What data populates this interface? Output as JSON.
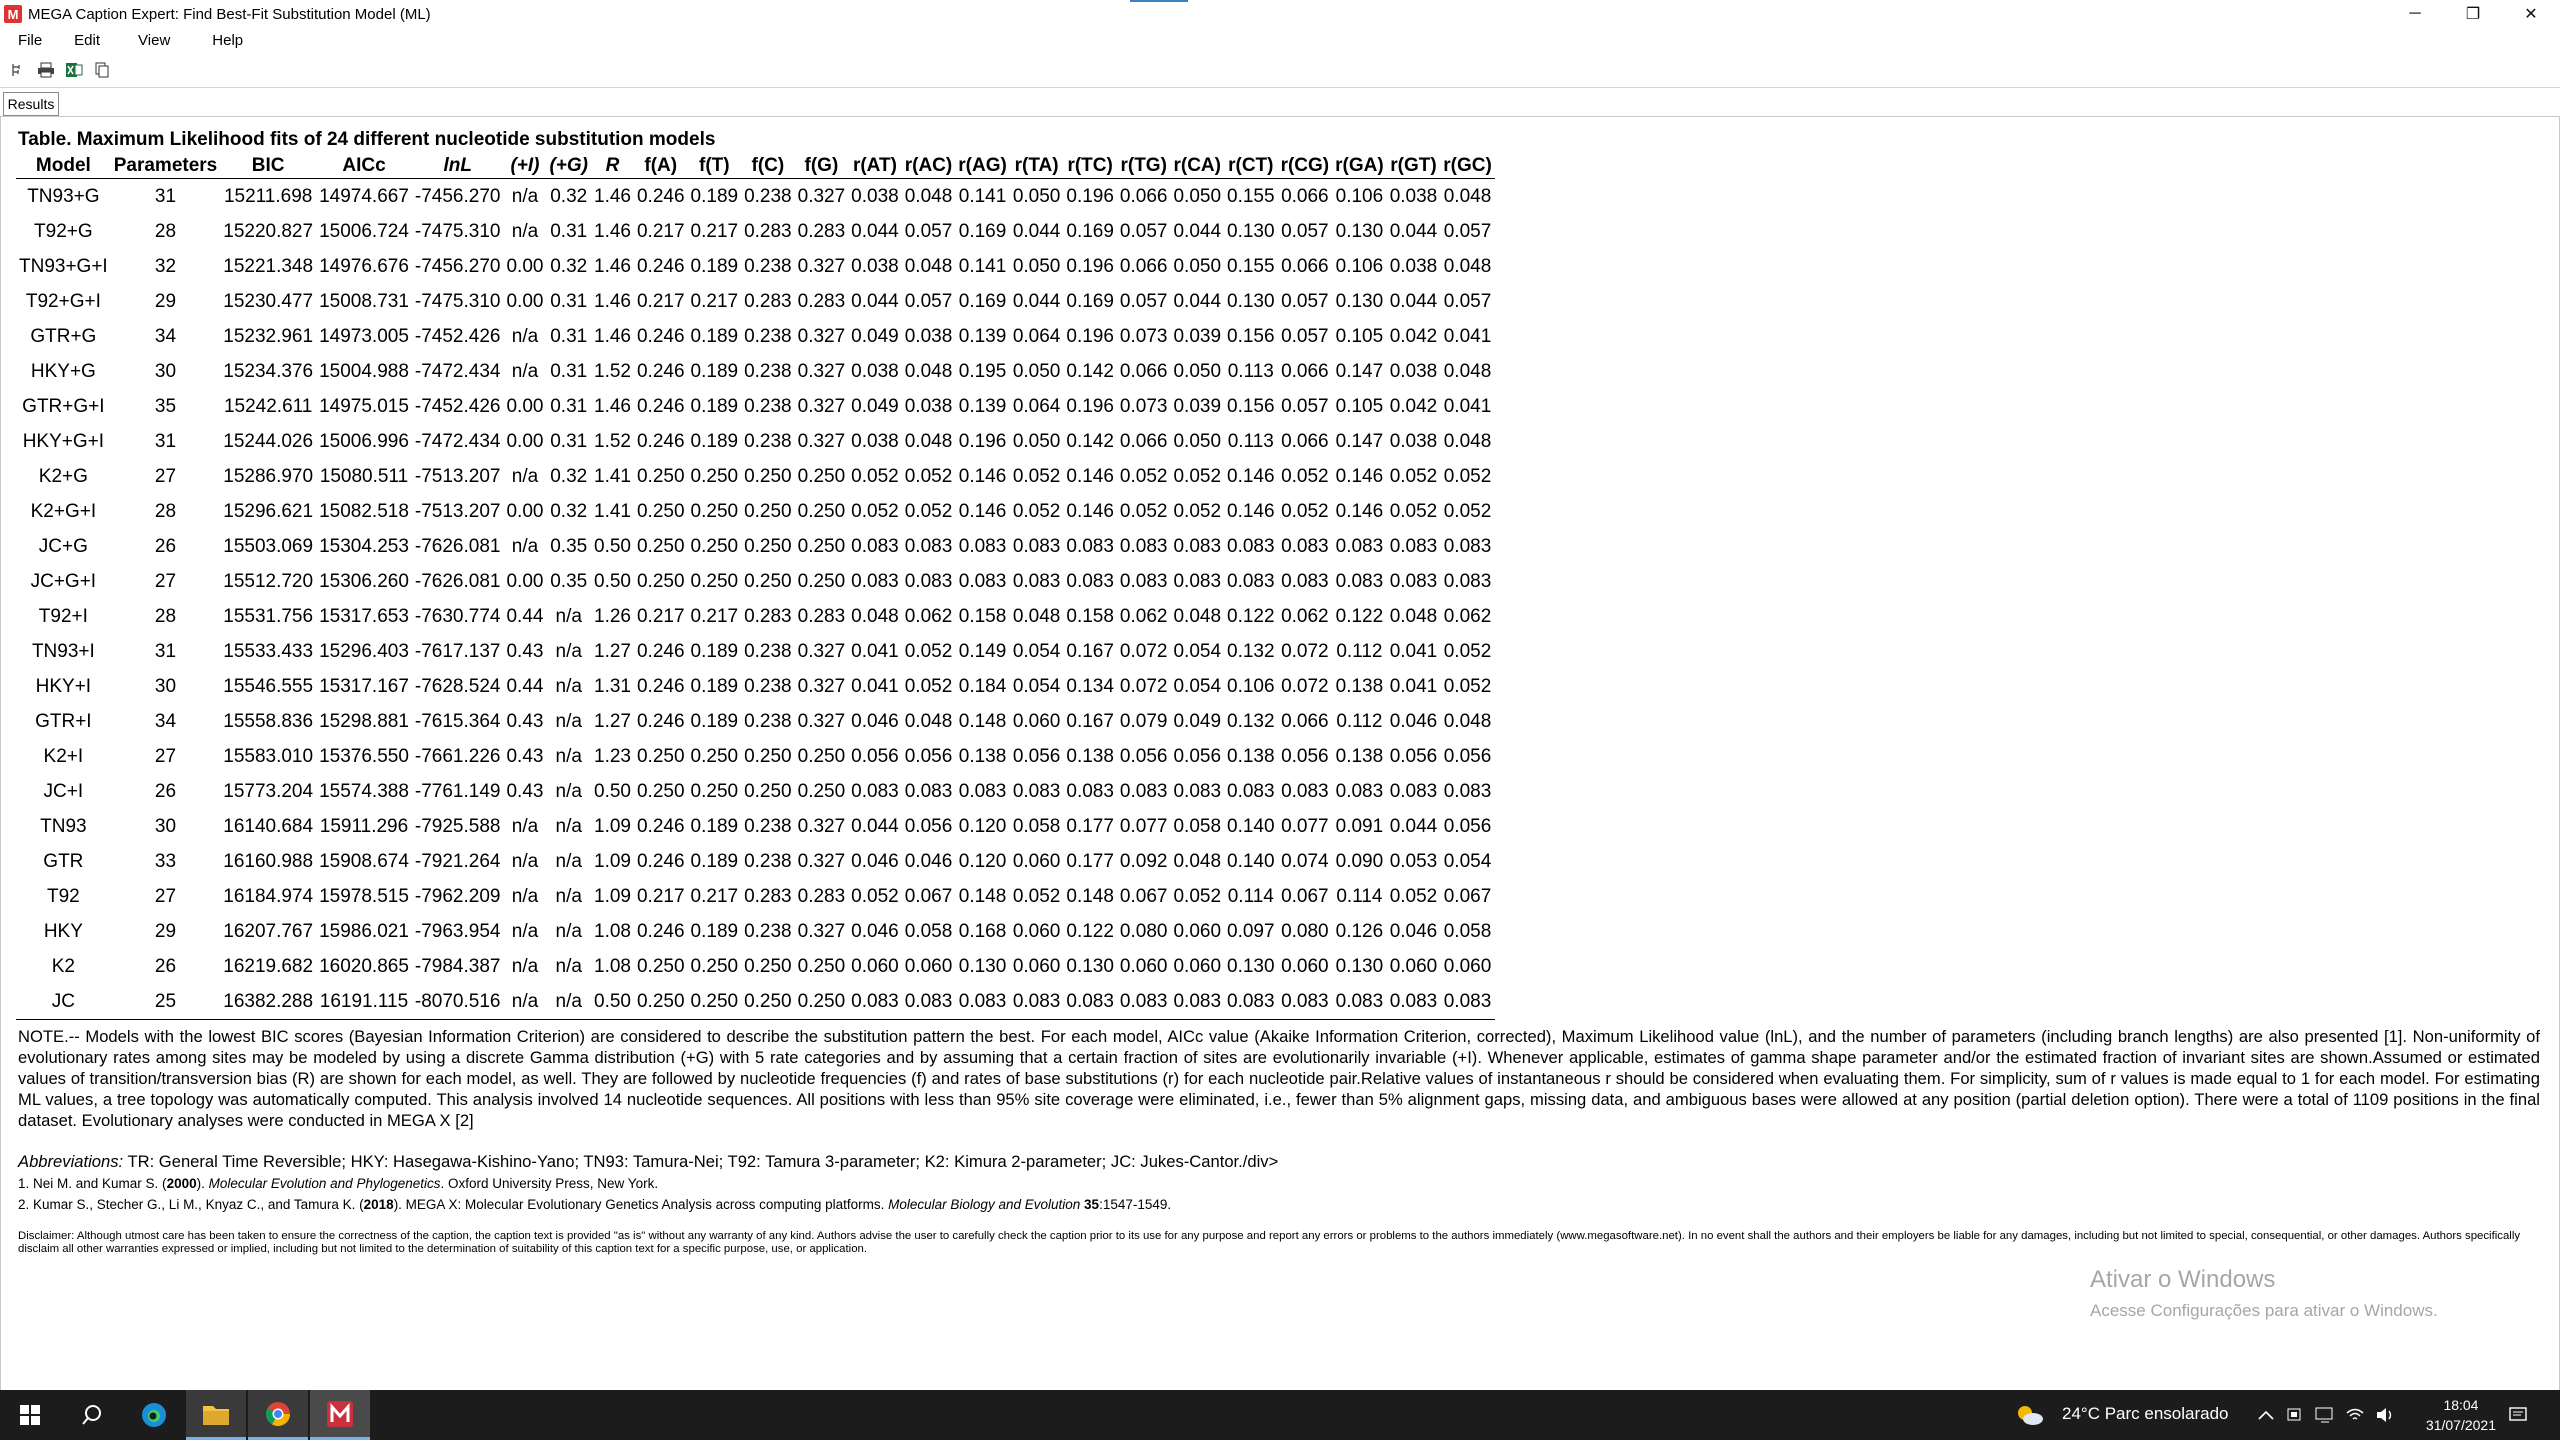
{
  "window": {
    "title": "MEGA Caption Expert: Find Best-Fit Substitution Model (ML)",
    "app_icon_letter": "M",
    "controls": {
      "minimize": "─",
      "restore": "❐",
      "close": "✕"
    }
  },
  "menu": {
    "file": "File",
    "edit": "Edit",
    "view": "View",
    "help": "Help"
  },
  "toolbar": {
    "icons": [
      "tree-icon",
      "print-icon",
      "excel-icon",
      "copy-icon"
    ]
  },
  "tab": {
    "label": "Results"
  },
  "table": {
    "title": "Table. Maximum Likelihood fits of 24 different nucleotide substitution models",
    "headers": [
      "Model",
      "Parameters",
      "BIC",
      "AICc",
      "lnL",
      "(+I)",
      "(+G)",
      "R",
      "f(A)",
      "f(T)",
      "f(C)",
      "f(G)",
      "r(AT)",
      "r(AC)",
      "r(AG)",
      "r(TA)",
      "r(TC)",
      "r(TG)",
      "r(CA)",
      "r(CT)",
      "r(CG)",
      "r(GA)",
      "r(GT)",
      "r(GC)"
    ],
    "rows": [
      [
        "TN93+G",
        "31",
        "15211.698",
        "14974.667",
        "-7456.270",
        "n/a",
        "0.32",
        "1.46",
        "0.246",
        "0.189",
        "0.238",
        "0.327",
        "0.038",
        "0.048",
        "0.141",
        "0.050",
        "0.196",
        "0.066",
        "0.050",
        "0.155",
        "0.066",
        "0.106",
        "0.038",
        "0.048"
      ],
      [
        "T92+G",
        "28",
        "15220.827",
        "15006.724",
        "-7475.310",
        "n/a",
        "0.31",
        "1.46",
        "0.217",
        "0.217",
        "0.283",
        "0.283",
        "0.044",
        "0.057",
        "0.169",
        "0.044",
        "0.169",
        "0.057",
        "0.044",
        "0.130",
        "0.057",
        "0.130",
        "0.044",
        "0.057"
      ],
      [
        "TN93+G+I",
        "32",
        "15221.348",
        "14976.676",
        "-7456.270",
        "0.00",
        "0.32",
        "1.46",
        "0.246",
        "0.189",
        "0.238",
        "0.327",
        "0.038",
        "0.048",
        "0.141",
        "0.050",
        "0.196",
        "0.066",
        "0.050",
        "0.155",
        "0.066",
        "0.106",
        "0.038",
        "0.048"
      ],
      [
        "T92+G+I",
        "29",
        "15230.477",
        "15008.731",
        "-7475.310",
        "0.00",
        "0.31",
        "1.46",
        "0.217",
        "0.217",
        "0.283",
        "0.283",
        "0.044",
        "0.057",
        "0.169",
        "0.044",
        "0.169",
        "0.057",
        "0.044",
        "0.130",
        "0.057",
        "0.130",
        "0.044",
        "0.057"
      ],
      [
        "GTR+G",
        "34",
        "15232.961",
        "14973.005",
        "-7452.426",
        "n/a",
        "0.31",
        "1.46",
        "0.246",
        "0.189",
        "0.238",
        "0.327",
        "0.049",
        "0.038",
        "0.139",
        "0.064",
        "0.196",
        "0.073",
        "0.039",
        "0.156",
        "0.057",
        "0.105",
        "0.042",
        "0.041"
      ],
      [
        "HKY+G",
        "30",
        "15234.376",
        "15004.988",
        "-7472.434",
        "n/a",
        "0.31",
        "1.52",
        "0.246",
        "0.189",
        "0.238",
        "0.327",
        "0.038",
        "0.048",
        "0.195",
        "0.050",
        "0.142",
        "0.066",
        "0.050",
        "0.113",
        "0.066",
        "0.147",
        "0.038",
        "0.048"
      ],
      [
        "GTR+G+I",
        "35",
        "15242.611",
        "14975.015",
        "-7452.426",
        "0.00",
        "0.31",
        "1.46",
        "0.246",
        "0.189",
        "0.238",
        "0.327",
        "0.049",
        "0.038",
        "0.139",
        "0.064",
        "0.196",
        "0.073",
        "0.039",
        "0.156",
        "0.057",
        "0.105",
        "0.042",
        "0.041"
      ],
      [
        "HKY+G+I",
        "31",
        "15244.026",
        "15006.996",
        "-7472.434",
        "0.00",
        "0.31",
        "1.52",
        "0.246",
        "0.189",
        "0.238",
        "0.327",
        "0.038",
        "0.048",
        "0.196",
        "0.050",
        "0.142",
        "0.066",
        "0.050",
        "0.113",
        "0.066",
        "0.147",
        "0.038",
        "0.048"
      ],
      [
        "K2+G",
        "27",
        "15286.970",
        "15080.511",
        "-7513.207",
        "n/a",
        "0.32",
        "1.41",
        "0.250",
        "0.250",
        "0.250",
        "0.250",
        "0.052",
        "0.052",
        "0.146",
        "0.052",
        "0.146",
        "0.052",
        "0.052",
        "0.146",
        "0.052",
        "0.146",
        "0.052",
        "0.052"
      ],
      [
        "K2+G+I",
        "28",
        "15296.621",
        "15082.518",
        "-7513.207",
        "0.00",
        "0.32",
        "1.41",
        "0.250",
        "0.250",
        "0.250",
        "0.250",
        "0.052",
        "0.052",
        "0.146",
        "0.052",
        "0.146",
        "0.052",
        "0.052",
        "0.146",
        "0.052",
        "0.146",
        "0.052",
        "0.052"
      ],
      [
        "JC+G",
        "26",
        "15503.069",
        "15304.253",
        "-7626.081",
        "n/a",
        "0.35",
        "0.50",
        "0.250",
        "0.250",
        "0.250",
        "0.250",
        "0.083",
        "0.083",
        "0.083",
        "0.083",
        "0.083",
        "0.083",
        "0.083",
        "0.083",
        "0.083",
        "0.083",
        "0.083",
        "0.083"
      ],
      [
        "JC+G+I",
        "27",
        "15512.720",
        "15306.260",
        "-7626.081",
        "0.00",
        "0.35",
        "0.50",
        "0.250",
        "0.250",
        "0.250",
        "0.250",
        "0.083",
        "0.083",
        "0.083",
        "0.083",
        "0.083",
        "0.083",
        "0.083",
        "0.083",
        "0.083",
        "0.083",
        "0.083",
        "0.083"
      ],
      [
        "T92+I",
        "28",
        "15531.756",
        "15317.653",
        "-7630.774",
        "0.44",
        "n/a",
        "1.26",
        "0.217",
        "0.217",
        "0.283",
        "0.283",
        "0.048",
        "0.062",
        "0.158",
        "0.048",
        "0.158",
        "0.062",
        "0.048",
        "0.122",
        "0.062",
        "0.122",
        "0.048",
        "0.062"
      ],
      [
        "TN93+I",
        "31",
        "15533.433",
        "15296.403",
        "-7617.137",
        "0.43",
        "n/a",
        "1.27",
        "0.246",
        "0.189",
        "0.238",
        "0.327",
        "0.041",
        "0.052",
        "0.149",
        "0.054",
        "0.167",
        "0.072",
        "0.054",
        "0.132",
        "0.072",
        "0.112",
        "0.041",
        "0.052"
      ],
      [
        "HKY+I",
        "30",
        "15546.555",
        "15317.167",
        "-7628.524",
        "0.44",
        "n/a",
        "1.31",
        "0.246",
        "0.189",
        "0.238",
        "0.327",
        "0.041",
        "0.052",
        "0.184",
        "0.054",
        "0.134",
        "0.072",
        "0.054",
        "0.106",
        "0.072",
        "0.138",
        "0.041",
        "0.052"
      ],
      [
        "GTR+I",
        "34",
        "15558.836",
        "15298.881",
        "-7615.364",
        "0.43",
        "n/a",
        "1.27",
        "0.246",
        "0.189",
        "0.238",
        "0.327",
        "0.046",
        "0.048",
        "0.148",
        "0.060",
        "0.167",
        "0.079",
        "0.049",
        "0.132",
        "0.066",
        "0.112",
        "0.046",
        "0.048"
      ],
      [
        "K2+I",
        "27",
        "15583.010",
        "15376.550",
        "-7661.226",
        "0.43",
        "n/a",
        "1.23",
        "0.250",
        "0.250",
        "0.250",
        "0.250",
        "0.056",
        "0.056",
        "0.138",
        "0.056",
        "0.138",
        "0.056",
        "0.056",
        "0.138",
        "0.056",
        "0.138",
        "0.056",
        "0.056"
      ],
      [
        "JC+I",
        "26",
        "15773.204",
        "15574.388",
        "-7761.149",
        "0.43",
        "n/a",
        "0.50",
        "0.250",
        "0.250",
        "0.250",
        "0.250",
        "0.083",
        "0.083",
        "0.083",
        "0.083",
        "0.083",
        "0.083",
        "0.083",
        "0.083",
        "0.083",
        "0.083",
        "0.083",
        "0.083"
      ],
      [
        "TN93",
        "30",
        "16140.684",
        "15911.296",
        "-7925.588",
        "n/a",
        "n/a",
        "1.09",
        "0.246",
        "0.189",
        "0.238",
        "0.327",
        "0.044",
        "0.056",
        "0.120",
        "0.058",
        "0.177",
        "0.077",
        "0.058",
        "0.140",
        "0.077",
        "0.091",
        "0.044",
        "0.056"
      ],
      [
        "GTR",
        "33",
        "16160.988",
        "15908.674",
        "-7921.264",
        "n/a",
        "n/a",
        "1.09",
        "0.246",
        "0.189",
        "0.238",
        "0.327",
        "0.046",
        "0.046",
        "0.120",
        "0.060",
        "0.177",
        "0.092",
        "0.048",
        "0.140",
        "0.074",
        "0.090",
        "0.053",
        "0.054"
      ],
      [
        "T92",
        "27",
        "16184.974",
        "15978.515",
        "-7962.209",
        "n/a",
        "n/a",
        "1.09",
        "0.217",
        "0.217",
        "0.283",
        "0.283",
        "0.052",
        "0.067",
        "0.148",
        "0.052",
        "0.148",
        "0.067",
        "0.052",
        "0.114",
        "0.067",
        "0.114",
        "0.052",
        "0.067"
      ],
      [
        "HKY",
        "29",
        "16207.767",
        "15986.021",
        "-7963.954",
        "n/a",
        "n/a",
        "1.08",
        "0.246",
        "0.189",
        "0.238",
        "0.327",
        "0.046",
        "0.058",
        "0.168",
        "0.060",
        "0.122",
        "0.080",
        "0.060",
        "0.097",
        "0.080",
        "0.126",
        "0.046",
        "0.058"
      ],
      [
        "K2",
        "26",
        "16219.682",
        "16020.865",
        "-7984.387",
        "n/a",
        "n/a",
        "1.08",
        "0.250",
        "0.250",
        "0.250",
        "0.250",
        "0.060",
        "0.060",
        "0.130",
        "0.060",
        "0.130",
        "0.060",
        "0.060",
        "0.130",
        "0.060",
        "0.130",
        "0.060",
        "0.060"
      ],
      [
        "JC",
        "25",
        "16382.288",
        "16191.115",
        "-8070.516",
        "n/a",
        "n/a",
        "0.50",
        "0.250",
        "0.250",
        "0.250",
        "0.250",
        "0.083",
        "0.083",
        "0.083",
        "0.083",
        "0.083",
        "0.083",
        "0.083",
        "0.083",
        "0.083",
        "0.083",
        "0.083",
        "0.083"
      ]
    ]
  },
  "note": "NOTE.-- Models with the lowest BIC scores (Bayesian Information Criterion) are considered to describe the substitution pattern the best. For each model, AICc value (Akaike Information Criterion, corrected), Maximum Likelihood value (lnL), and the number of parameters (including branch lengths) are also presented [1]. Non-uniformity of evolutionary rates among sites may be modeled by using a discrete Gamma distribution (+G) with 5 rate categories and by assuming that a certain fraction of sites are evolutionarily invariable (+I). Whenever applicable, estimates of gamma shape parameter and/or the estimated fraction of invariant sites are shown.Assumed or estimated values of transition/transversion bias (R) are shown for each model, as well. They are followed by nucleotide frequencies (f) and rates of base substitutions (r) for each nucleotide pair.Relative values of instantaneous r should be considered when evaluating them. For simplicity, sum of r values is made equal to 1 for each model. For estimating ML values, a tree topology was automatically computed. This analysis involved 14 nucleotide sequences. All positions with less than 95% site coverage were eliminated, i.e., fewer than 5% alignment gaps, missing data, and ambiguous bases were allowed at any position (partial deletion option). There were a total of 1109 positions in the final dataset. Evolutionary analyses were conducted in MEGA X [2]",
  "abbreviations": {
    "label": "Abbreviations:",
    "text": " TR: General Time Reversible; HKY: Hasegawa-Kishino-Yano; TN93: Tamura-Nei; T92: Tamura 3-parameter; K2: Kimura 2-parameter; JC: Jukes-Cantor./div>"
  },
  "references": {
    "ref1": {
      "prefix": "1. Nei M. and Kumar S. (",
      "year": "2000",
      "mid": "). ",
      "title": "Molecular Evolution and Phylogenetics",
      "suffix": ". Oxford University Press, New York."
    },
    "ref2": {
      "prefix": "2. Kumar S., Stecher G., Li M., Knyaz C., and Tamura K. (",
      "year": "2018",
      "mid": "). MEGA X: Molecular Evolutionary Genetics Analysis across computing platforms. ",
      "journal": "Molecular Biology and Evolution",
      "volume": "35",
      "pages": ":1547-1549."
    }
  },
  "disclaimer": "Disclaimer: Although utmost care has been taken to ensure the correctness of the caption, the caption text is provided \"as is\" without any warranty of any kind. Authors advise the user to carefully check the caption prior to its use for any purpose and report any errors or problems to the authors immediately (www.megasoftware.net). In no event shall the authors and their employers be liable for any damages, including but not limited to special, consequential, or other damages. Authors specifically disclaim all other warranties expressed or implied, including but not limited to the determination of suitability of this caption text for a specific purpose, use, or application.",
  "watermark": {
    "title": "Ativar o Windows",
    "subtitle": "Acesse Configurações para ativar o Windows."
  },
  "taskbar": {
    "weather": "24°C  Parc ensolarado",
    "time": "18:04",
    "date": "31/07/2021"
  }
}
